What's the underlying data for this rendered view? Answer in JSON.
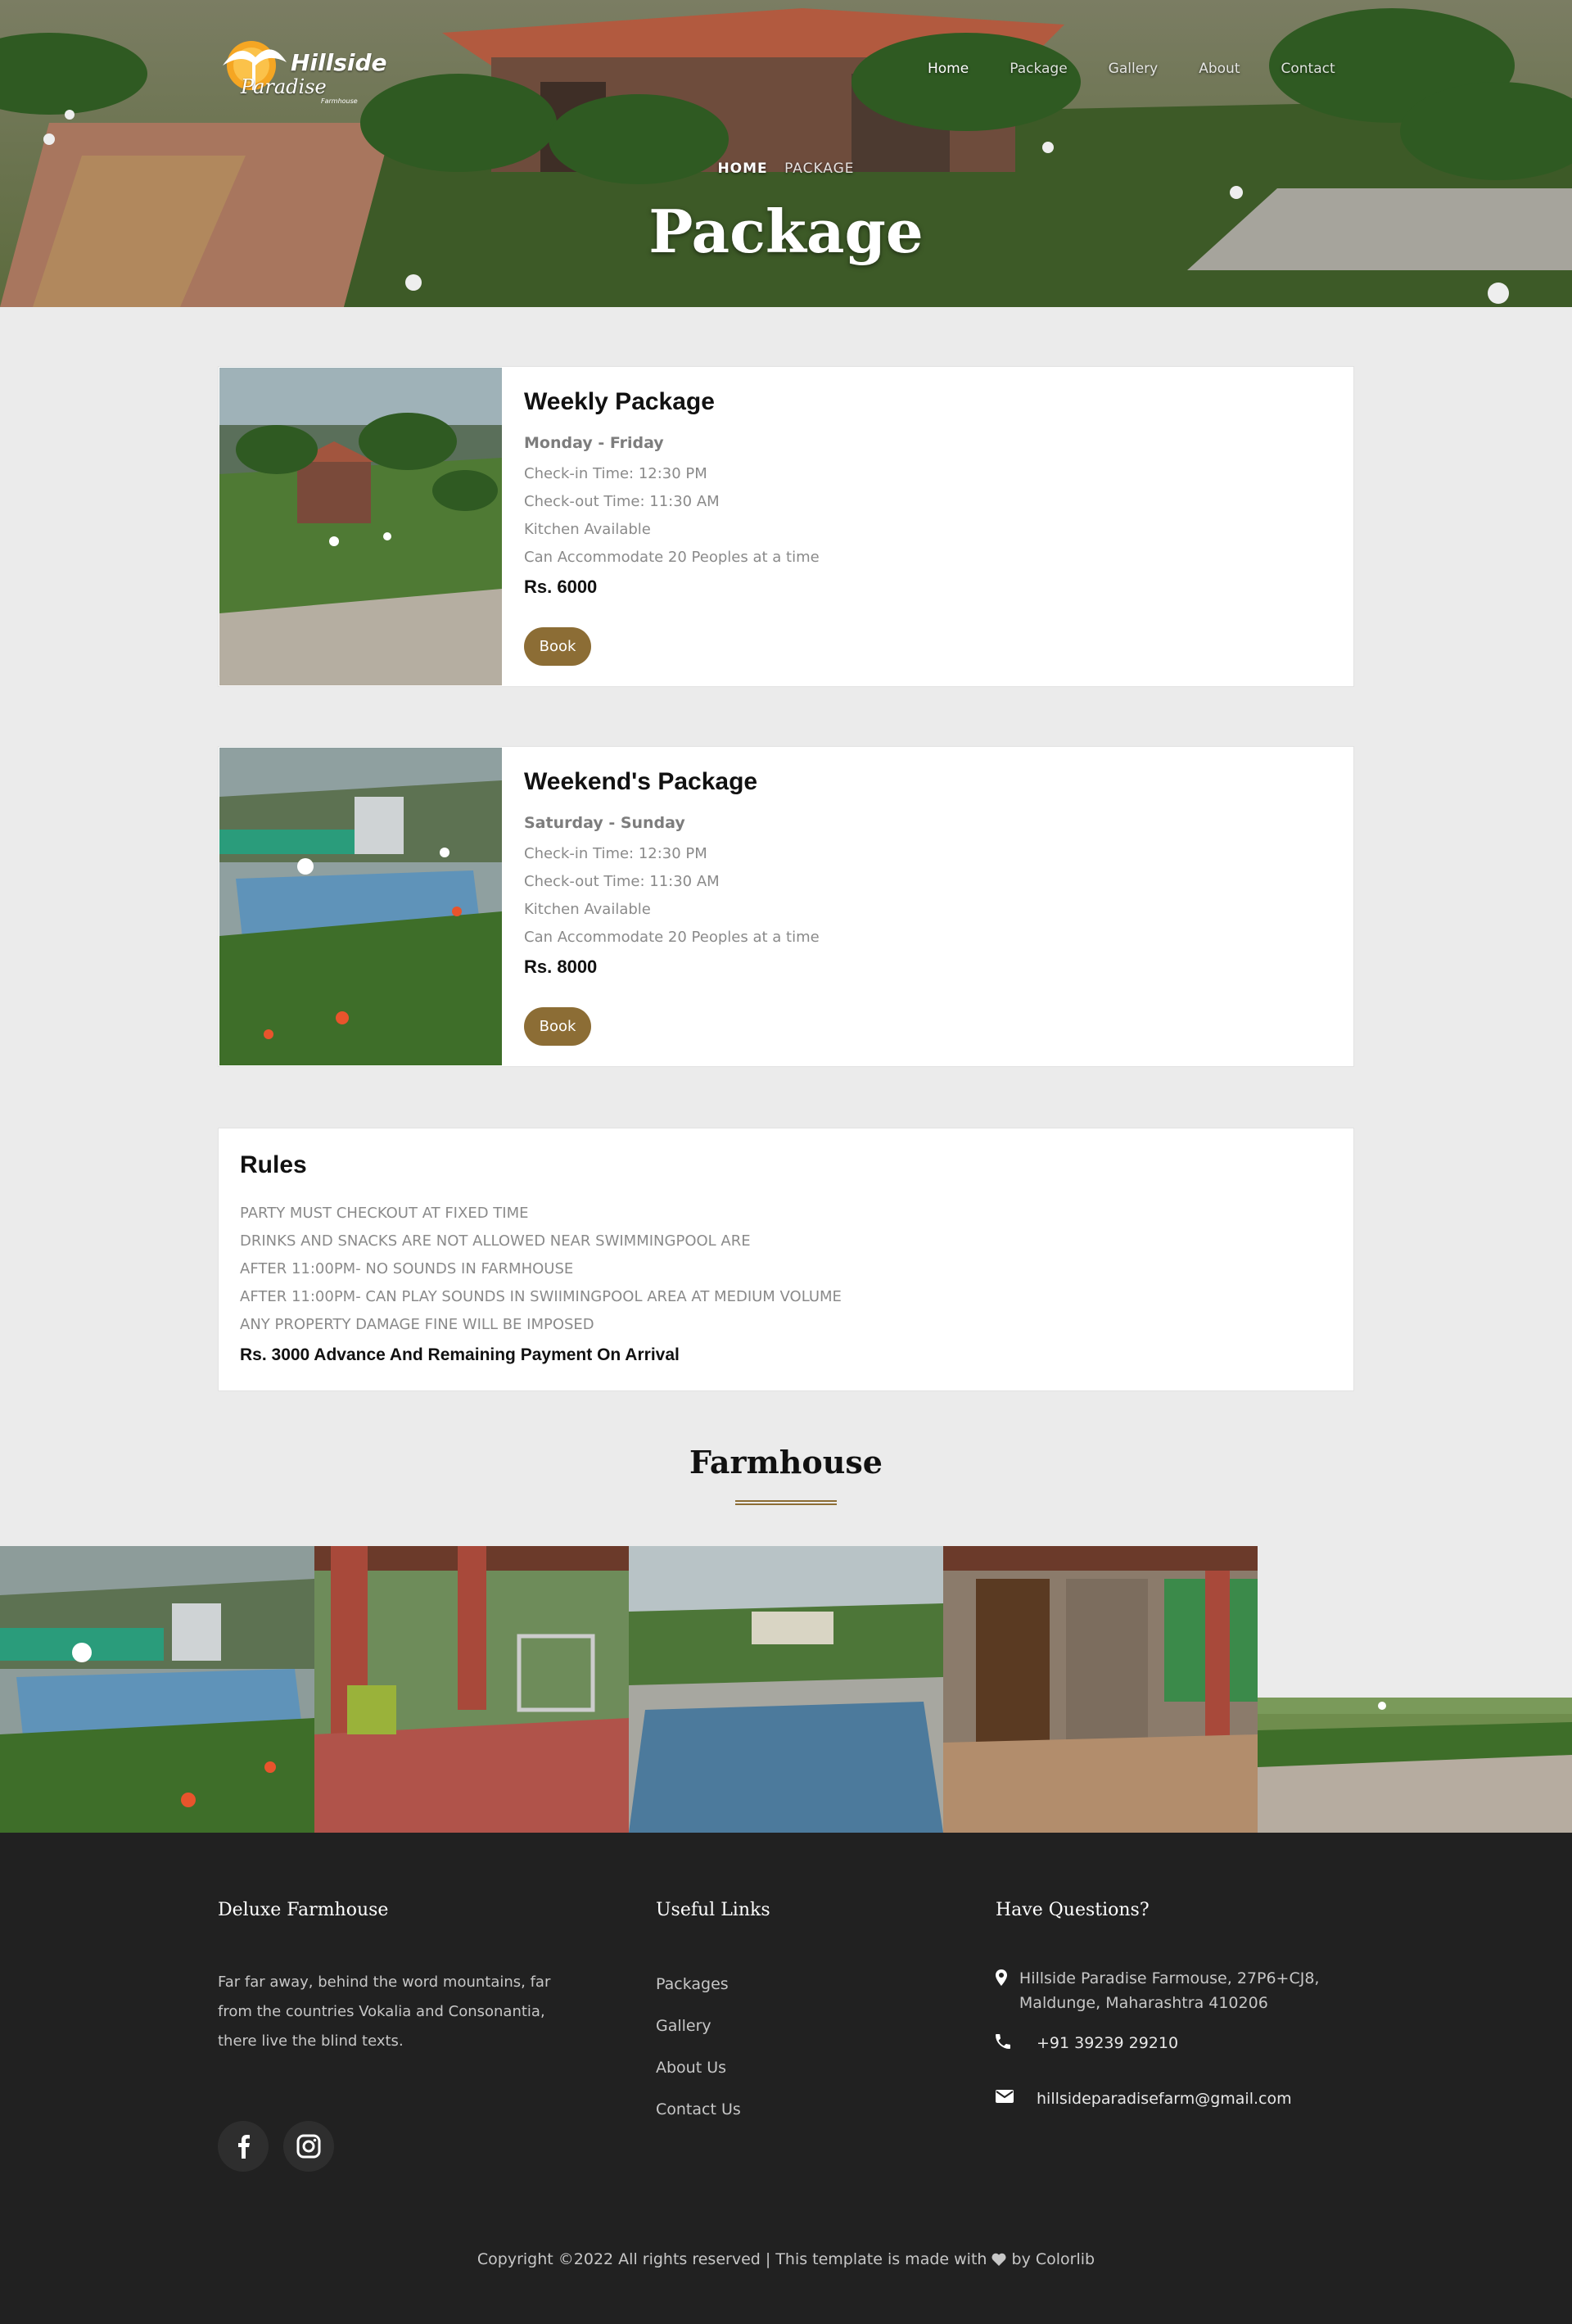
{
  "brand": {
    "name": "Hillside",
    "script": "Paradise",
    "sub": "Farmhouse"
  },
  "nav": {
    "items": [
      {
        "label": "Home",
        "active": true
      },
      {
        "label": "Package",
        "active": false
      },
      {
        "label": "Gallery",
        "active": false
      },
      {
        "label": "About",
        "active": false
      },
      {
        "label": "Contact",
        "active": false
      }
    ]
  },
  "hero": {
    "breadcrumb_home": "HOME",
    "breadcrumb_current": "PACKAGE",
    "title": "Package"
  },
  "packages": [
    {
      "title": "Weekly Package",
      "days": "Monday - Friday",
      "checkin": "Check-in Time: 12:30 PM",
      "checkout": "Check-out Time: 11:30 AM",
      "kitchen": "Kitchen Available",
      "capacity": "Can Accommodate 20 Peoples at a time",
      "price": "Rs. 6000",
      "button": "Book"
    },
    {
      "title": "Weekend's Package",
      "days": "Saturday - Sunday",
      "checkin": "Check-in Time: 12:30 PM",
      "checkout": "Check-out Time: 11:30 AM",
      "kitchen": "Kitchen Available",
      "capacity": "Can Accommodate 20 Peoples at a time",
      "price": "Rs. 8000",
      "button": "Book"
    }
  ],
  "rules": {
    "title": "Rules",
    "items": [
      "PARTY MUST CHECKOUT AT FIXED TIME",
      "DRINKS AND SNACKS ARE NOT ALLOWED NEAR SWIMMINGPOOL ARE",
      "AFTER 11:00PM- NO SOUNDS IN FARMHOUSE",
      "AFTER 11:00PM- CAN PLAY SOUNDS IN SWIIMINGPOOL AREA AT MEDIUM VOLUME",
      "ANY PROPERTY DAMAGE FINE WILL BE IMPOSED"
    ],
    "advance": "Rs. 3000 Advance And Remaining Payment On Arrival"
  },
  "gallery": {
    "title": "Farmhouse"
  },
  "footer": {
    "about_title": "Deluxe Farmhouse",
    "about_text": "Far far away, behind the word mountains, far from the countries Vokalia and Consonantia, there live the blind texts.",
    "social": [
      "facebook-icon",
      "instagram-icon"
    ],
    "links_title": "Useful Links",
    "links": [
      "Packages",
      "Gallery",
      "About Us",
      "Contact Us"
    ],
    "contact_title": "Have Questions?",
    "address": "Hillside Paradise Farmouse, 27P6+CJ8, Maldunge, Maharashtra 410206",
    "phone": "+91 39239 29210",
    "email": "hillsideparadisefarm@gmail.com",
    "copyright_left": "Copyright ©2022 All rights reserved | This template is made with",
    "copyright_right": "by Colorlib"
  },
  "colors": {
    "accent": "#8c6d35",
    "page_bg": "#ebebeb",
    "footer_bg": "#212121"
  }
}
